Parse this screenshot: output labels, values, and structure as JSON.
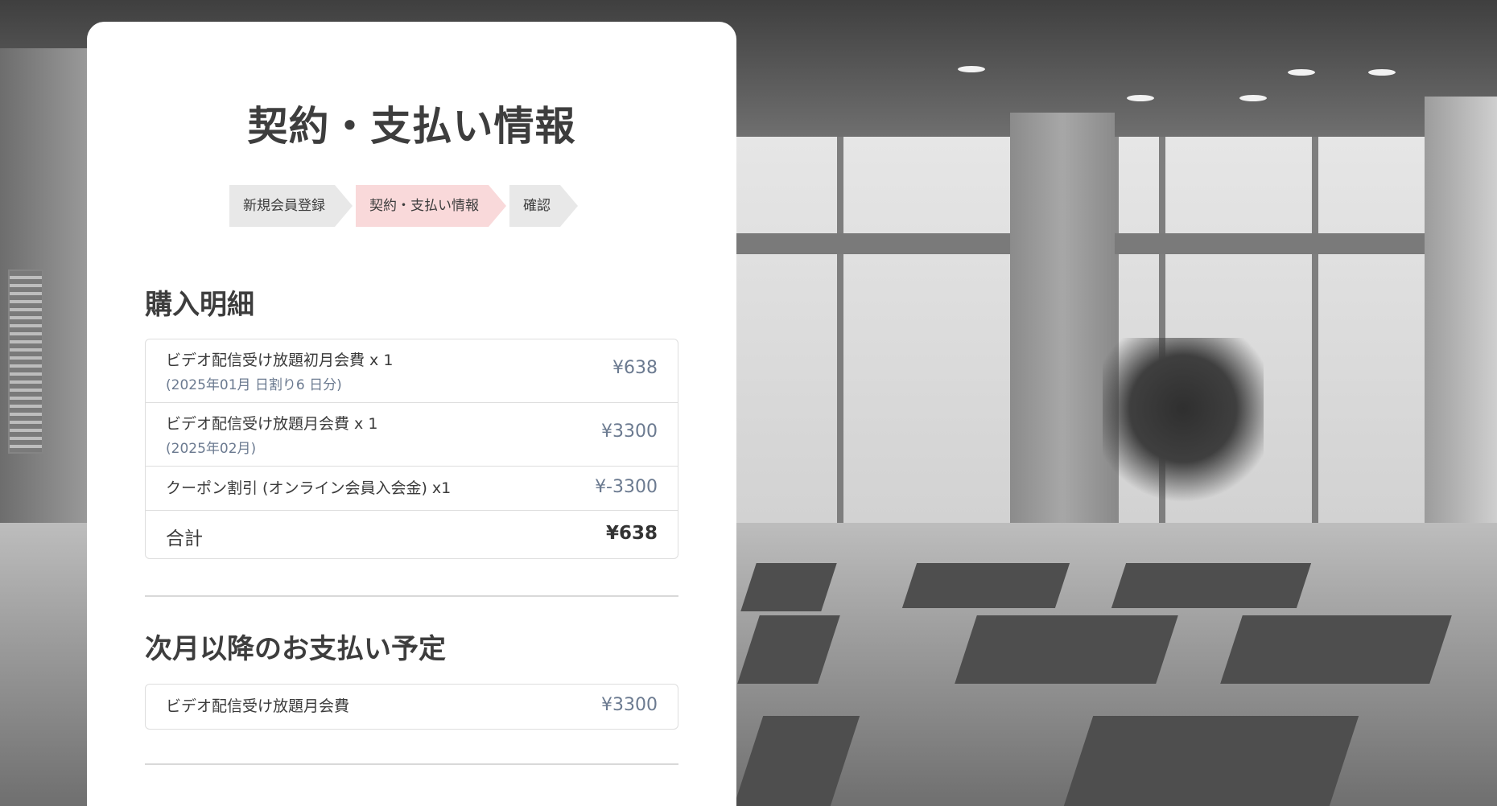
{
  "page": {
    "title": "契約・支払い情報"
  },
  "stepper": {
    "steps": [
      {
        "label": "新規会員登録",
        "active": false
      },
      {
        "label": "契約・支払い情報",
        "active": true
      },
      {
        "label": "確認",
        "active": false
      }
    ],
    "active_color": "#f9d9da",
    "inactive_color": "#e8e8e8"
  },
  "purchase": {
    "heading": "購入明細",
    "items": [
      {
        "name": "ビデオ配信受け放題初月会費 x 1",
        "note": "(2025年01月 日割り6 日分)",
        "price": "¥638"
      },
      {
        "name": "ビデオ配信受け放題月会費 x 1",
        "note": "(2025年02月)",
        "price": "¥3300"
      },
      {
        "name": "クーポン割引 (オンライン会員入会金) x1",
        "note": "",
        "price": "¥-3300"
      }
    ],
    "total": {
      "label": "合計",
      "price": "¥638"
    }
  },
  "schedule": {
    "heading": "次月以降のお支払い予定",
    "items": [
      {
        "name": "ビデオ配信受け放題月会費",
        "price": "¥3300"
      }
    ]
  },
  "colors": {
    "price_text": "#6b7a90",
    "card_bg": "#ffffff"
  }
}
